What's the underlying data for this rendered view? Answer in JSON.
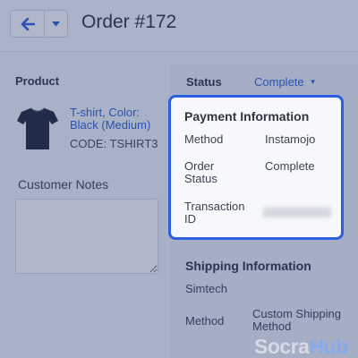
{
  "header": {
    "title": "Order #172"
  },
  "product": {
    "section_label": "Product",
    "name": "T-shirt, Color: Black (Medium)",
    "code": "CODE: TSHIRT3"
  },
  "notes": {
    "label": "Customer Notes",
    "value": ""
  },
  "status": {
    "label": "Status",
    "value": "Complete"
  },
  "payment": {
    "title": "Payment Information",
    "rows": [
      {
        "key": "Method",
        "value": "Instamojo"
      },
      {
        "key": "Order Status",
        "value": "Complete"
      },
      {
        "key": "Transaction ID",
        "value": ""
      }
    ]
  },
  "shipping": {
    "title": "Shipping Information",
    "carrier": "Simtech",
    "method_label": "Method",
    "method_value": "Custom Shipping Method"
  },
  "watermark": {
    "part1": "Socra",
    "part2": "Hub"
  },
  "icons": {
    "back": "arrow-left-icon",
    "dropdown": "chevron-down-icon",
    "product_image": "tshirt-icon"
  },
  "colors": {
    "accent": "#2b5fe0",
    "link": "#2f5fd6"
  }
}
